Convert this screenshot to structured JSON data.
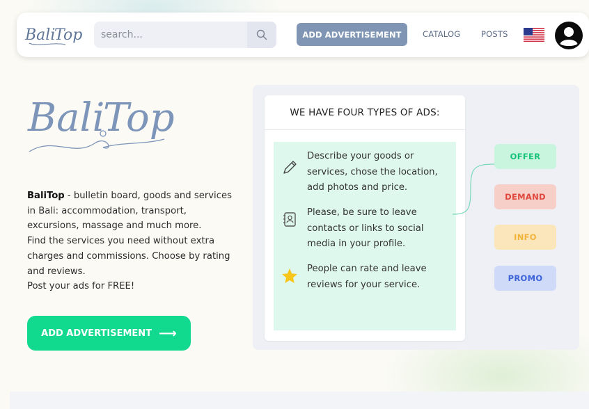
{
  "header": {
    "logo_alt": "Bali Top",
    "search_placeholder": "search...",
    "add_button": "ADD ADVERTISEMENT",
    "nav": [
      "CATALOG",
      "POSTS"
    ],
    "language_flag": "us-flag-icon",
    "user_icon": "user-avatar-icon"
  },
  "hero": {
    "logo_text": "Bali Top",
    "brand": "BaliTop",
    "description": " - bulletin board, goods and services in Bali: accommodation, transport, excursions, massage and much more.",
    "line2": "Find the services you need without extra charges and commissions. Choose by rating and reviews.",
    "line3": "Post your ads for FREE!",
    "cta_label": "ADD ADVERTISEMENT",
    "cta_arrow": "⟶"
  },
  "types": {
    "title": "WE HAVE FOUR TYPES OF ADS:",
    "features": [
      {
        "icon": "pencil-icon",
        "text": "Describe your goods or services, chose the location, add photos and price."
      },
      {
        "icon": "contact-card-icon",
        "text": "Please, be sure to leave contacts or links to social media in your profile."
      },
      {
        "icon": "star-icon",
        "text": "People can rate and leave reviews for your service."
      }
    ],
    "tags": [
      {
        "label": "OFFER",
        "color": "#16c27a",
        "bg": "#c9f5de"
      },
      {
        "label": "DEMAND",
        "color": "#e0473c",
        "bg": "#f6cfc9"
      },
      {
        "label": "INFO",
        "color": "#f2b338",
        "bg": "#fbe6bc"
      },
      {
        "label": "PROMO",
        "color": "#3c62d8",
        "bg": "#cfdaf9"
      }
    ]
  },
  "colors": {
    "accent_green": "#11d98d",
    "header_button": "#7f95b3",
    "logo_blue": "#7c95b8"
  }
}
